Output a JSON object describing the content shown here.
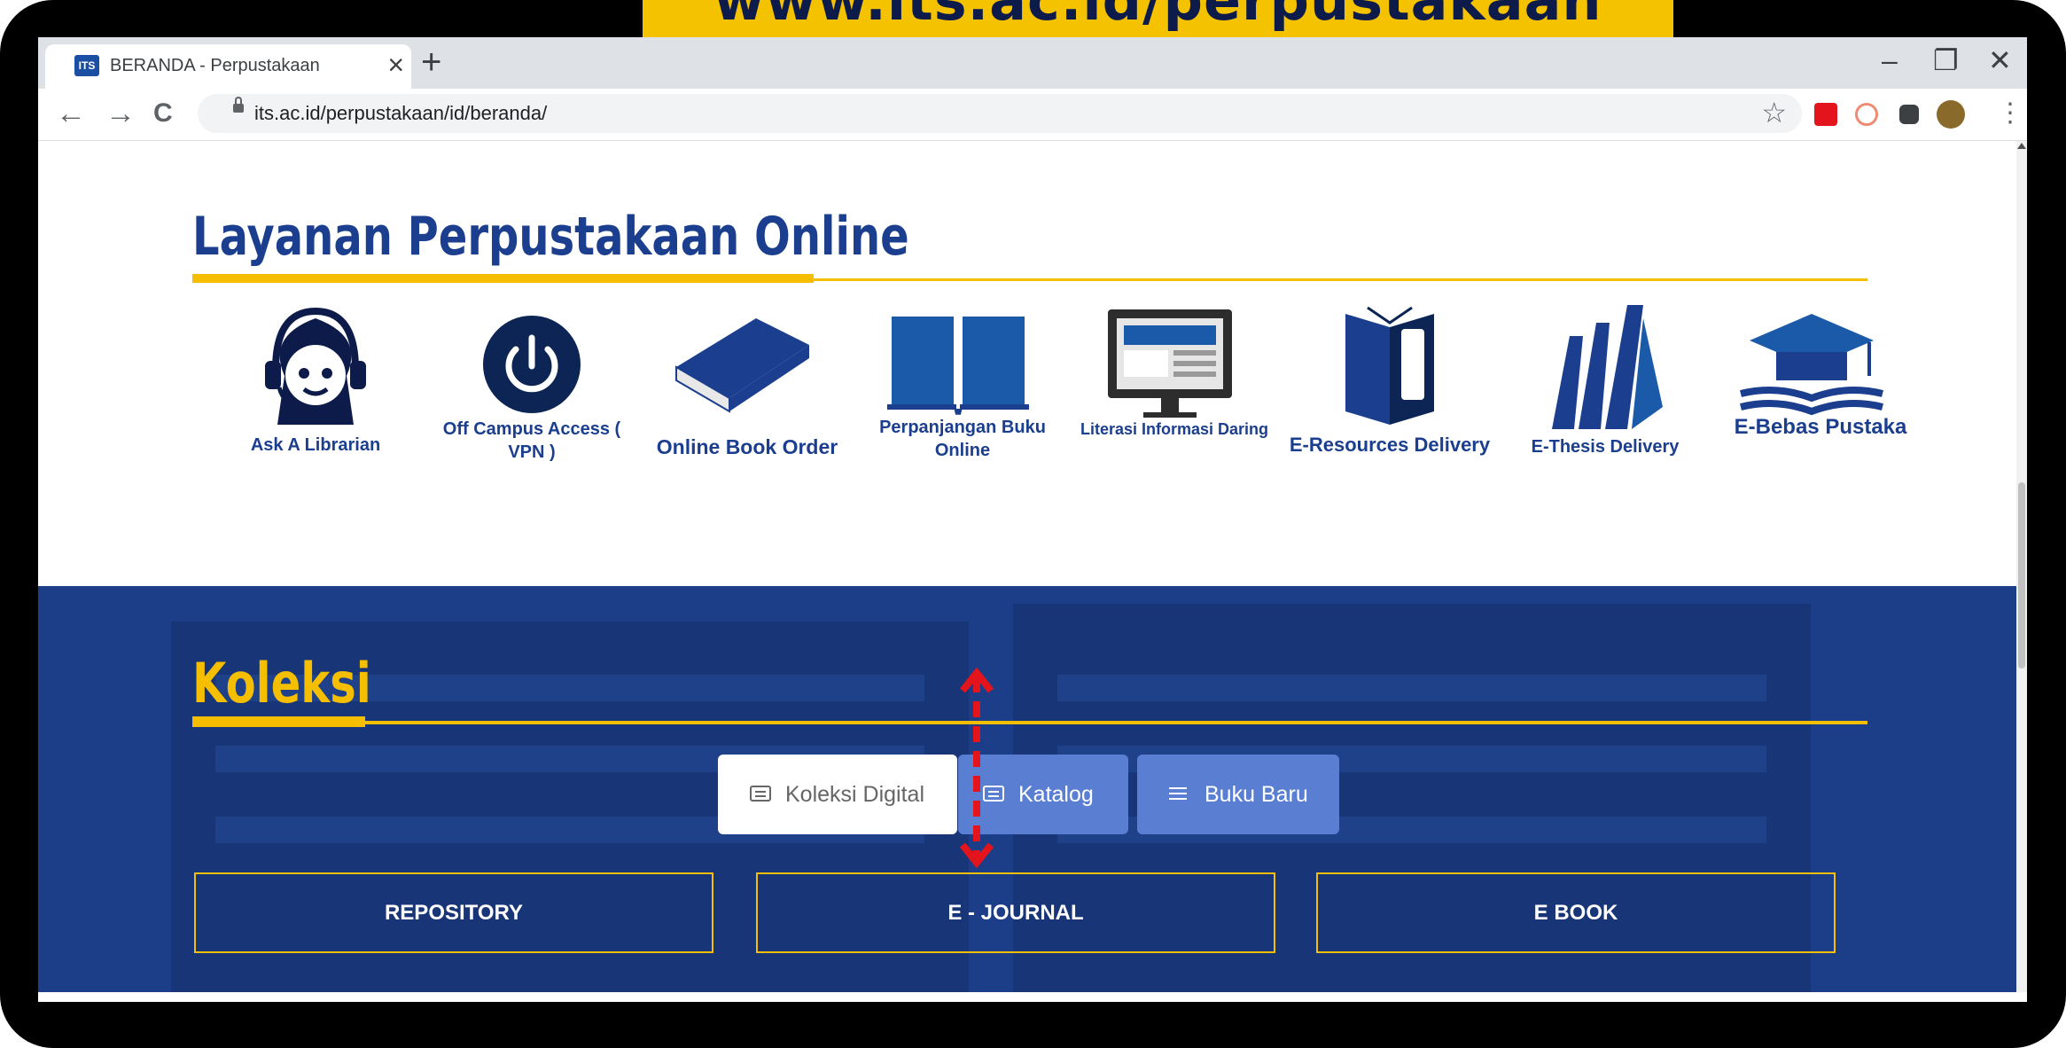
{
  "banner": {
    "text": "www.its.ac.id/perpustakaan"
  },
  "browser": {
    "tab": {
      "favicon": "ITS",
      "title": "BERANDA - Perpustakaan",
      "close": "×"
    },
    "new_tab": "+",
    "window_controls": {
      "minimize": "–",
      "restore": "❐",
      "close": "✕"
    },
    "nav": {
      "back": "←",
      "forward": "→",
      "reload": "C"
    },
    "url": "its.ac.id/perpustakaan/id/beranda/",
    "star": "☆",
    "menu": "⋮",
    "extension_icons": [
      "mail-icon",
      "notes-icon",
      "puzzle-icon",
      "profile-icon"
    ]
  },
  "layanan": {
    "title": "Layanan Perpustakaan Online",
    "services": [
      {
        "label": "Ask A Librarian",
        "icon": "headset-person-icon"
      },
      {
        "label": "Off Campus Access ( VPN )",
        "icon": "power-icon"
      },
      {
        "label": "Online Book Order",
        "icon": "book-icon"
      },
      {
        "label": "Perpanjangan Buku Online",
        "icon": "open-book-icon"
      },
      {
        "label": "Literasi Informasi Daring",
        "icon": "monitor-icon"
      },
      {
        "label": "E-Resources Delivery",
        "icon": "ebook-device-icon"
      },
      {
        "label": "E-Thesis Delivery",
        "icon": "books-icon"
      },
      {
        "label": "E-Bebas Pustaka",
        "icon": "graduation-cap-icon"
      }
    ]
  },
  "koleksi": {
    "title": "Koleksi",
    "tabs": [
      {
        "label": "Koleksi Digital",
        "icon": "message-icon"
      },
      {
        "label": "Katalog",
        "icon": "message-icon"
      },
      {
        "label": "Buku Baru",
        "icon": "menu-icon"
      }
    ],
    "links": [
      "REPOSITORY",
      "E - JOURNAL",
      "E BOOK"
    ]
  },
  "colors": {
    "brand_blue": "#1b3f8e",
    "accent_yellow": "#f5bf00",
    "tab_blue": "#5a7ed1",
    "annotation_red": "#e3141c"
  }
}
